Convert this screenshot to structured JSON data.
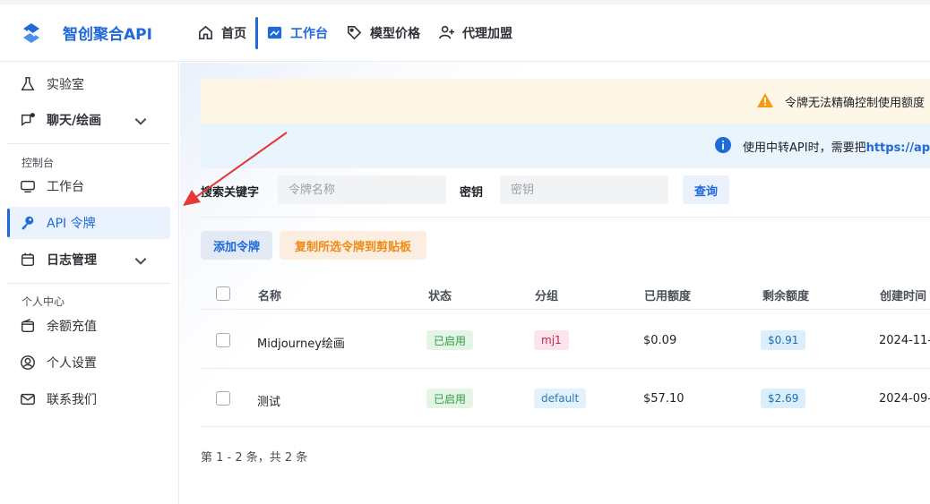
{
  "brand": {
    "name": "智创聚合API"
  },
  "nav": [
    {
      "label": "首页",
      "icon": "home-icon"
    },
    {
      "label": "工作台",
      "icon": "workbench-icon",
      "active": true
    },
    {
      "label": "模型价格",
      "icon": "tag-icon"
    },
    {
      "label": "代理加盟",
      "icon": "user-add-icon"
    }
  ],
  "sidebar": {
    "lab": "实验室",
    "chat": "聊天/绘画",
    "section_console": "控制台",
    "workbench": "工作台",
    "api_token": "API 令牌",
    "log": "日志管理",
    "section_personal": "个人中心",
    "topup": "余额充值",
    "settings": "个人设置",
    "contact": "联系我们"
  },
  "banners": {
    "warning": "令牌无法精确控制使用额度",
    "info_prefix": "使用中转API时，需要把",
    "info_link": "https://ap"
  },
  "search": {
    "keyword_label": "搜索关键字",
    "keyword_placeholder": "令牌名称",
    "key_label": "密钥",
    "key_placeholder": "密钥",
    "query_button": "查询"
  },
  "actions": {
    "add_token": "添加令牌",
    "copy_selected": "复制所选令牌到剪贴板"
  },
  "table": {
    "headers": [
      "名称",
      "状态",
      "分组",
      "已用额度",
      "剩余额度",
      "创建时间"
    ],
    "rows": [
      {
        "name": "Midjourney绘画",
        "status": "已启用",
        "group": "mj1",
        "used": "$0.09",
        "remaining": "$0.91",
        "created": "2024-11-"
      },
      {
        "name": "测试",
        "status": "已启用",
        "group": "default",
        "used": "$57.10",
        "remaining": "$2.69",
        "created": "2024-09-"
      }
    ]
  },
  "pagination": {
    "summary": "第 1 - 2 条，共 2 条"
  },
  "colors": {
    "accent": "#1f69d8",
    "warning": "#ef8a17",
    "annotation_arrow": "#e53935"
  }
}
